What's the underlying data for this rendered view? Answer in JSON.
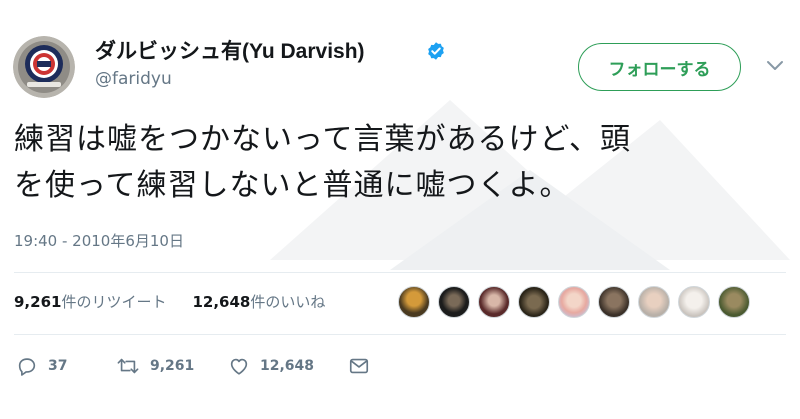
{
  "author": {
    "display_name": "ダルビッシュ有(Yu Darvish)",
    "handle": "@faridyu",
    "avatar_icon": "cubs-logo-icon",
    "verified_icon": "verified-badge-icon"
  },
  "follow_button": {
    "label": "フォローする"
  },
  "menu": {
    "icon": "chevron-down-icon"
  },
  "tweet": {
    "line1": "練習は嘘をつかないって言葉があるけど、頭",
    "line2": "を使って練習しないと普通に嘘つくよ。"
  },
  "timestamp": "19:40 - 2010年6月10日",
  "stats": {
    "retweets_count": "9,261",
    "retweets_label": "件のリツイート",
    "likes_count": "12,648",
    "likes_label": "件のいいね"
  },
  "actions": {
    "reply_count": "37",
    "retweet_count": "9,261",
    "like_count": "12,648"
  },
  "colors": {
    "follow_green": "#2e9e58",
    "verified_blue": "#1da1f2",
    "secondary_text": "#657786"
  }
}
